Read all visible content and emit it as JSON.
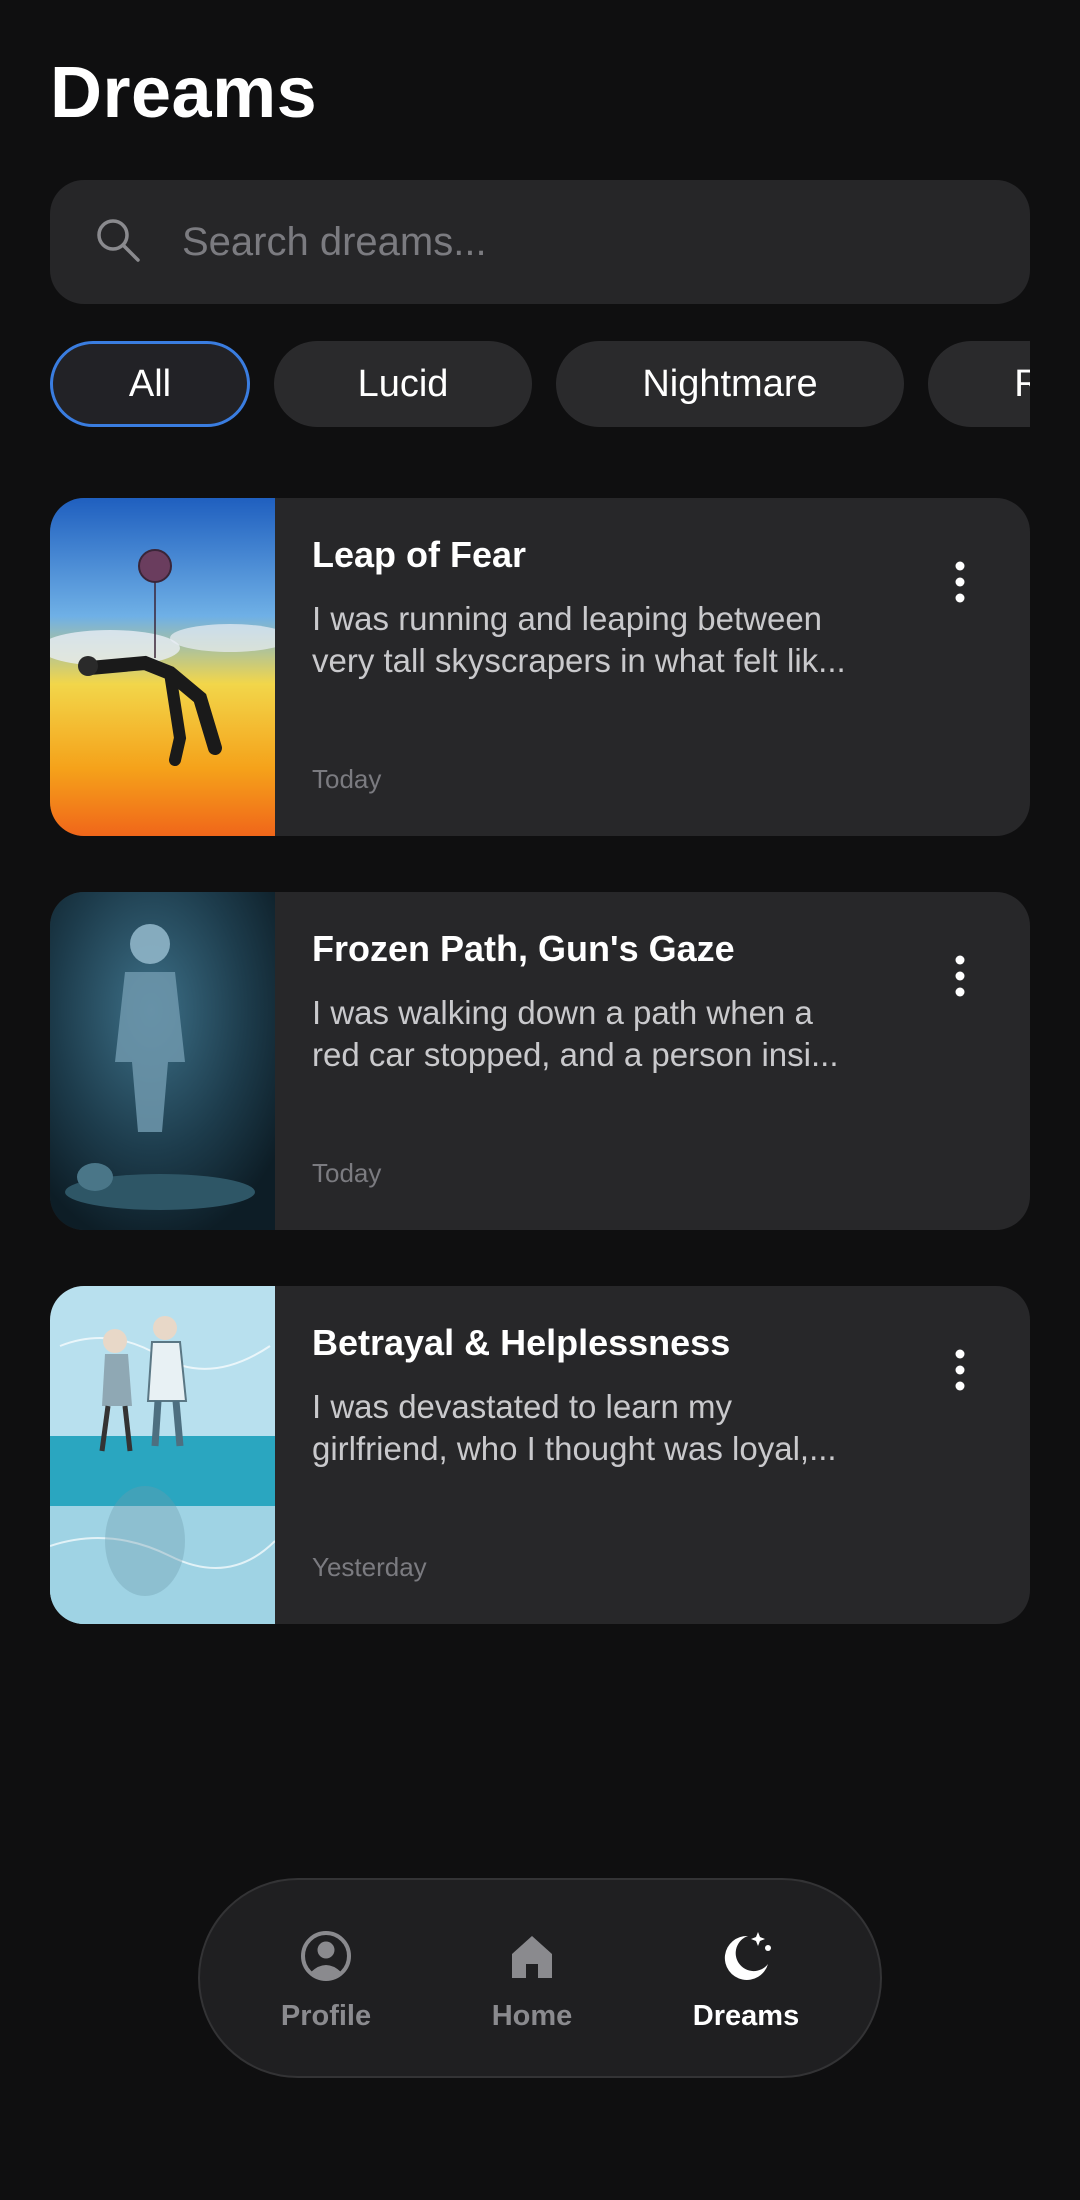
{
  "header": {
    "title": "Dreams"
  },
  "search": {
    "placeholder": "Search dreams..."
  },
  "filters": [
    {
      "label": "All",
      "active": true
    },
    {
      "label": "Lucid",
      "active": false
    },
    {
      "label": "Nightmare",
      "active": false
    },
    {
      "label": "R",
      "active": false
    }
  ],
  "dreams": [
    {
      "title": "Leap of Fear",
      "excerpt_line1": "I was running and leaping between",
      "excerpt_line2": "very tall skyscrapers in what felt lik...",
      "date": "Today"
    },
    {
      "title": "Frozen Path, Gun's Gaze",
      "excerpt_line1": "I was walking down a path when a",
      "excerpt_line2": "red car stopped, and a person insi...",
      "date": "Today"
    },
    {
      "title": "Betrayal & Helplessness",
      "excerpt_line1": "I was devastated to learn my",
      "excerpt_line2": "girlfriend, who I thought was loyal,...",
      "date": "Yesterday"
    }
  ],
  "nav": {
    "profile_label": "Profile",
    "home_label": "Home",
    "dreams_label": "Dreams",
    "active": "Dreams"
  },
  "colors": {
    "background": "#0f0f10",
    "card": "#272729",
    "accent": "#3a7de0",
    "muted_text": "#7b7b80"
  }
}
